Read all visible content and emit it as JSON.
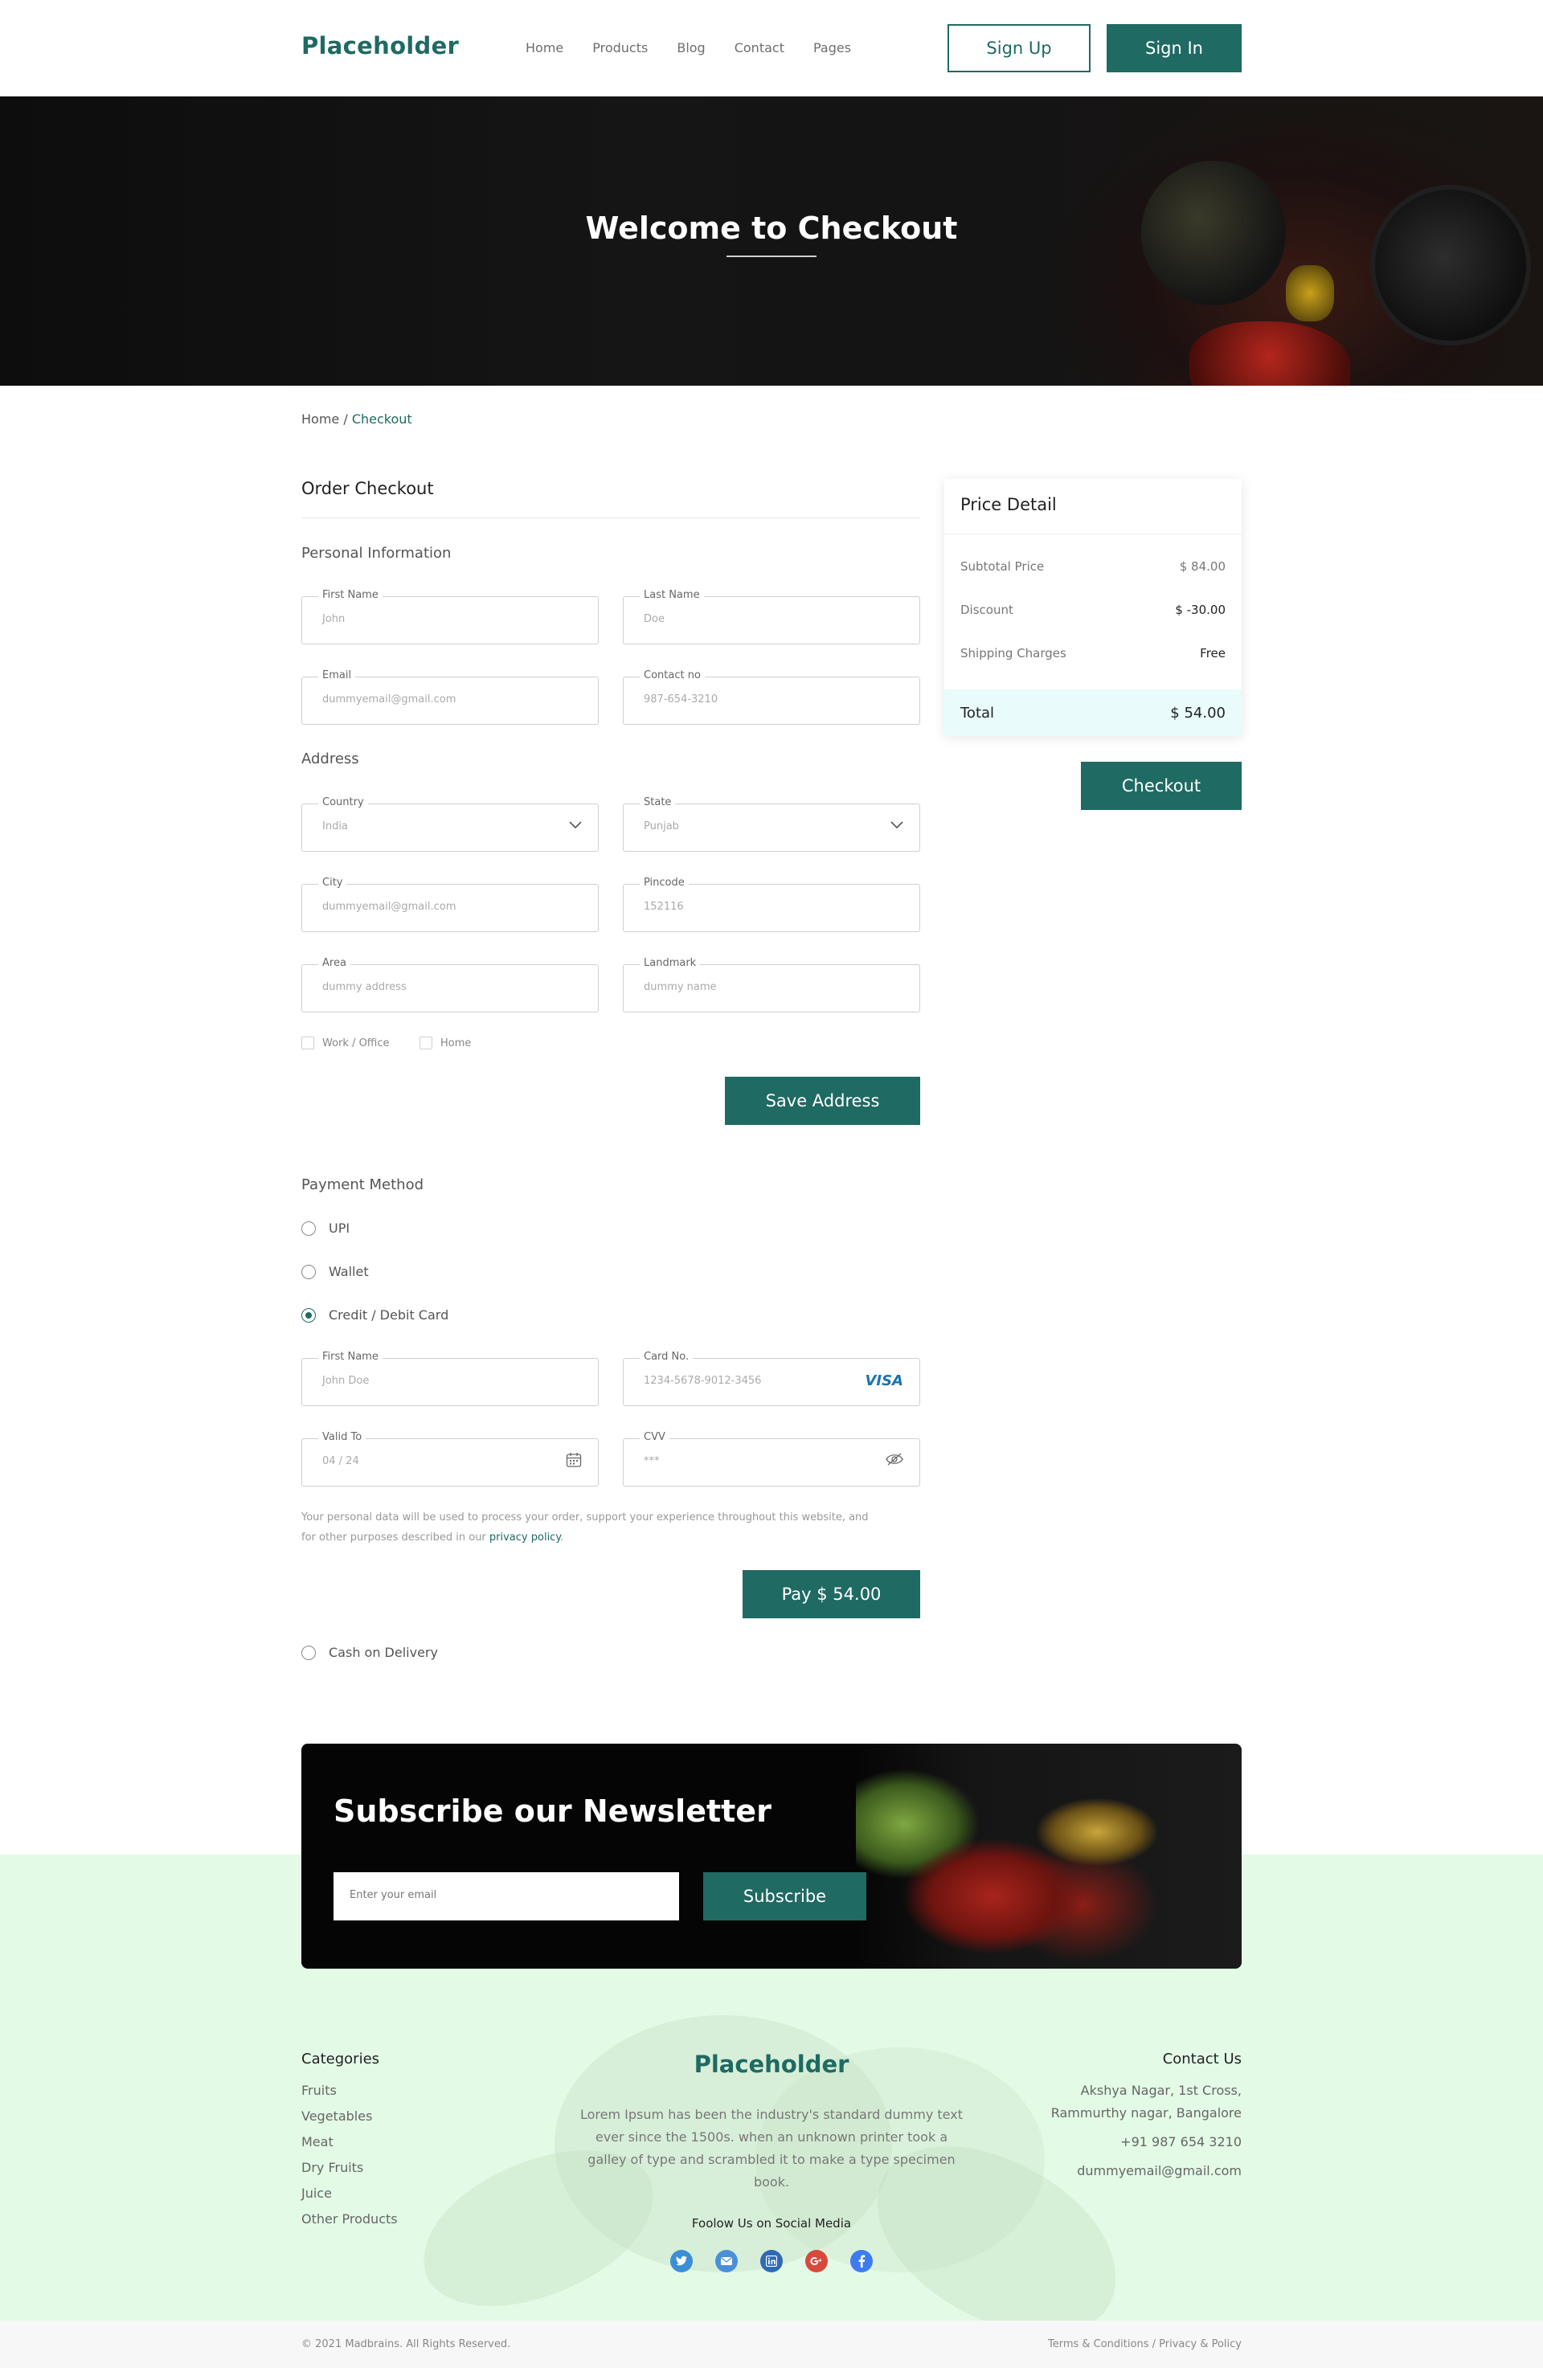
{
  "header": {
    "logo": "Placeholder",
    "nav": [
      "Home",
      "Products",
      "Blog",
      "Contact",
      "Pages"
    ],
    "signup_label": "Sign Up",
    "signin_label": "Sign In"
  },
  "hero": {
    "title": "Welcome to Checkout"
  },
  "breadcrumb": {
    "home": "Home",
    "separator": " / ",
    "current": "Checkout"
  },
  "checkout": {
    "title": "Order Checkout",
    "personal_title": "Personal Information",
    "first_name": {
      "label": "First Name",
      "placeholder": "John"
    },
    "last_name": {
      "label": "Last Name",
      "placeholder": "Doe"
    },
    "email": {
      "label": "Email",
      "placeholder": "dummyemail@gmail.com"
    },
    "contact": {
      "label": "Contact no",
      "placeholder": "987-654-3210"
    },
    "address_title": "Address",
    "country": {
      "label": "Country",
      "value": "India"
    },
    "state": {
      "label": "State",
      "value": "Punjab"
    },
    "city": {
      "label": "City",
      "placeholder": "dummyemail@gmail.com"
    },
    "pincode": {
      "label": "Pincode",
      "placeholder": "152116"
    },
    "area": {
      "label": "Area",
      "placeholder": "dummy address"
    },
    "landmark": {
      "label": "Landmark",
      "placeholder": "dummy name"
    },
    "checkbox_work": "Work / Office",
    "checkbox_home": "Home",
    "save_address_label": "Save Address"
  },
  "payment": {
    "title": "Payment Method",
    "options": {
      "upi": "UPI",
      "wallet": "Wallet",
      "card": "Credit / Debit Card",
      "cod": "Cash on Delivery"
    },
    "selected": "card",
    "card_first_name": {
      "label": "First Name",
      "placeholder": "John Doe"
    },
    "card_no": {
      "label": "Card No.",
      "placeholder": "1234-5678-9012-3456",
      "brand": "VISA"
    },
    "valid_to": {
      "label": "Valid To",
      "placeholder": "04 / 24"
    },
    "cvv": {
      "label": "CVV",
      "placeholder": "***"
    },
    "notice_line1": "Your personal data will be used to process your order, support your experience throughout this website, and",
    "notice_line2": "for other purposes described in our ",
    "notice_link": "privacy policy",
    "notice_end": ".",
    "pay_label": "Pay $ 54.00"
  },
  "price_detail": {
    "title": "Price Detail",
    "rows": [
      {
        "label": "Subtotal Price",
        "value": "$ 84.00"
      },
      {
        "label": "Discount",
        "value": "$ -30.00"
      },
      {
        "label": "Shipping Charges",
        "value": "Free"
      }
    ],
    "total_label": "Total",
    "total_value": "$ 54.00",
    "checkout_label": "Checkout"
  },
  "newsletter": {
    "title": "Subscribe our Newsletter",
    "input_placeholder": "Enter your email",
    "button_label": "Subscribe"
  },
  "footer": {
    "categories_title": "Categories",
    "categories": [
      "Fruits",
      "Vegetables",
      "Meat",
      "Dry Fruits",
      "Juice",
      "Other Products"
    ],
    "logo": "Placeholder",
    "description": "Lorem Ipsum has been the industry's standard dummy text ever since the 1500s. when an unknown printer took a galley of type and scrambled it to make a type specimen book.",
    "social_title": "Foolow Us on Social Media",
    "social_icons": [
      "twitter-icon",
      "mail-icon",
      "linkedin-icon",
      "google-plus-icon",
      "facebook-icon"
    ],
    "contact_title": "Contact Us",
    "address_line1": "Akshya Nagar, 1st Cross,",
    "address_line2": "Rammurthy nagar, Bangalore",
    "phone": "+91 987 654 3210",
    "email": "dummyemail@gmail.com",
    "copyright": "© 2021 Madbrains. All Rights Reserved.",
    "terms": "Terms & Conditions",
    "legal_sep": " / ",
    "privacy": "Privacy & Policy"
  },
  "colors": {
    "brand": "#1f6a63",
    "footer_bg": "#e3fae6",
    "total_bg": "#e9fbfb"
  }
}
